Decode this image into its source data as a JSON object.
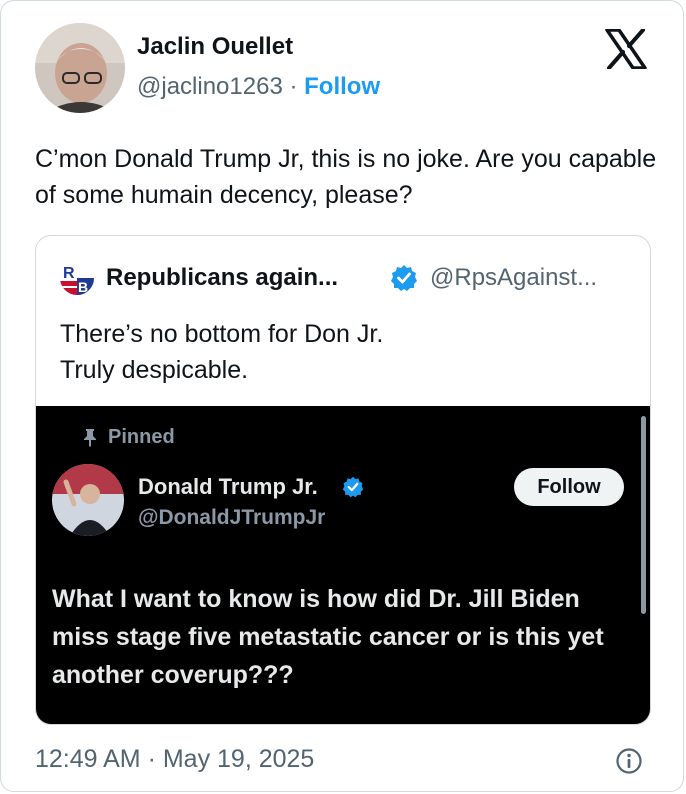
{
  "author": {
    "name": "Jaclin Ouellet",
    "handle": "@jaclino1263",
    "separator": "·",
    "follow_label": "Follow"
  },
  "post": {
    "text": "C’mon Donald Trump Jr, this is no joke. Are you capable of some humain decency, please?"
  },
  "quoted": {
    "name": "Republicans again...",
    "handle": "@RpsAgainst...",
    "line1": "There’s no bottom for Don Jr.",
    "line2": "Truly despicable."
  },
  "media": {
    "pinned_label": "Pinned",
    "name": "Donald Trump Jr.",
    "handle": "@DonaldJTrumpJr",
    "follow_label": "Follow",
    "text": "What I want to know is how did Dr. Jill Biden miss stage five metastatic cancer or is this yet another coverup???"
  },
  "footer": {
    "timestamp": "12:49 AM · May 19, 2025"
  },
  "colors": {
    "link_blue": "#1d9bf0",
    "muted_gray": "#536471",
    "verified_blue": "#1d9bf0"
  },
  "icons": {
    "logo": "x-logo-icon",
    "verified": "verified-badge-icon",
    "pin": "pin-icon",
    "info": "info-icon"
  }
}
